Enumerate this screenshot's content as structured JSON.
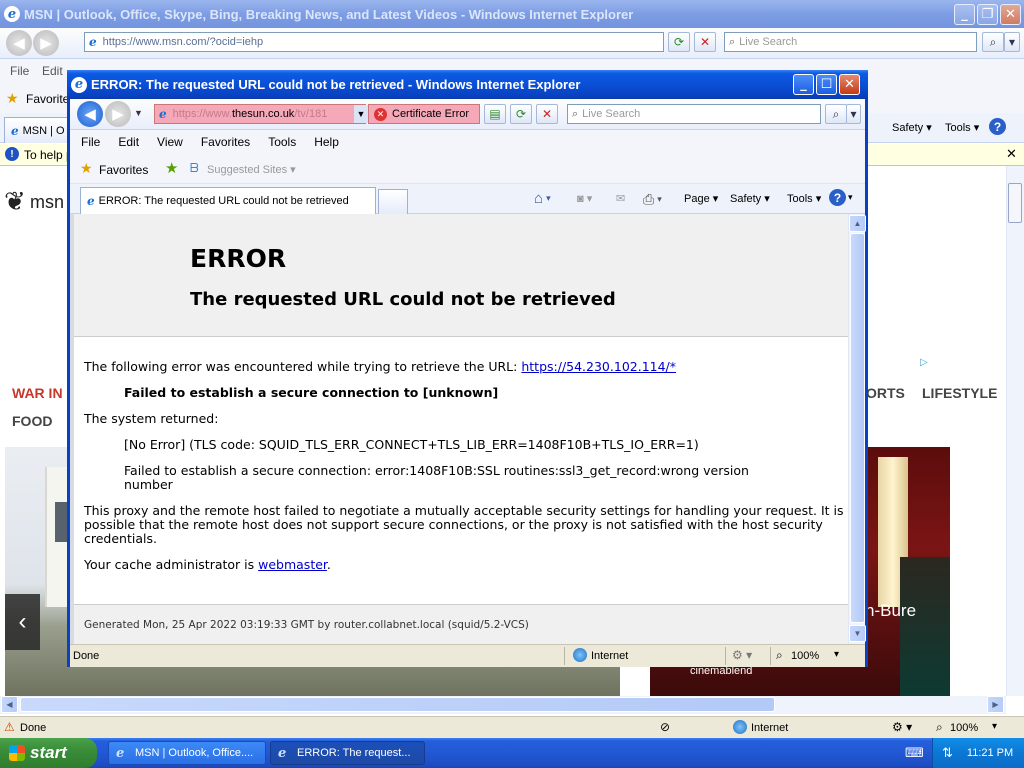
{
  "back_window": {
    "title": "MSN | Outlook, Office, Skype, Bing, Breaking News, and Latest Videos - Windows Internet Explorer",
    "address": "https://www.msn.com/?ocid=iehp",
    "search_placeholder": "Live Search",
    "menu": [
      "File",
      "Edit"
    ],
    "favorites_label": "Favorites",
    "tab_label": "MSN | O",
    "infobar_text": "To help p",
    "cmd_items": [
      "Safety",
      "Tools"
    ],
    "msn_logo": "msn",
    "nav_items": [
      "WAR IN U",
      "ORTS",
      "LIFESTYLE"
    ],
    "nav_food": "FOOD",
    "photo_caption": "n-Bure",
    "photo_sub": "cinemablend",
    "status_text": "Done",
    "zone_text": "Internet",
    "zoom_text": "100%"
  },
  "window": {
    "title": "ERROR: The requested URL could not be retrieved - Windows Internet Explorer",
    "address_prefix": "https://www.",
    "address_host": "thesun.co.uk",
    "address_suffix": "/tv/181",
    "cert_error": "Certificate Error",
    "search_placeholder": "Live Search",
    "menu": [
      "File",
      "Edit",
      "View",
      "Favorites",
      "Tools",
      "Help"
    ],
    "favorites_label": "Favorites",
    "suggested_sites": "Suggested Sites",
    "tab_label": "ERROR: The requested URL could not be retrieved",
    "cmd_page": "Page",
    "cmd_safety": "Safety",
    "cmd_tools": "Tools",
    "status_text": "Done",
    "zone_text": "Internet",
    "zoom_text": "100%"
  },
  "error_page": {
    "heading": "ERROR",
    "subheading": "The requested URL could not be retrieved",
    "intro": "The following error was encountered while trying to retrieve the URL: ",
    "url_link": "https://54.230.102.114/*",
    "failed_msg": "Failed to establish a secure connection to [unknown]",
    "system_returned": "The system returned:",
    "tls_code": "[No Error] (TLS code: SQUID_TLS_ERR_CONNECT+TLS_LIB_ERR=1408F10B+TLS_IO_ERR=1)",
    "ssl_error": "Failed to establish a secure connection: error:1408F10B:SSL routines:ssl3_get_record:wrong version number",
    "explanation": "This proxy and the remote host failed to negotiate a mutually acceptable security settings for handling your request. It is possible that the remote host does not support secure connections, or the proxy is not satisfied with the host security credentials.",
    "admin_prefix": "Your cache administrator is ",
    "admin_link": "webmaster",
    "admin_suffix": ".",
    "generated": "Generated Mon, 25 Apr 2022 03:19:33 GMT by router.collabnet.local (squid/5.2-VCS)"
  },
  "taskbar": {
    "start": "start",
    "items": [
      "MSN | Outlook, Office....",
      "ERROR: The request..."
    ],
    "clock": "11:21 PM"
  }
}
